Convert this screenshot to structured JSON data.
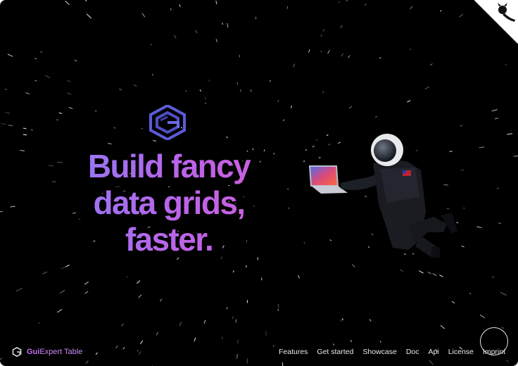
{
  "hero": {
    "line1": "Build fancy",
    "line2": "data grids,",
    "line3": "faster."
  },
  "brand": {
    "bold": "Gui",
    "rest": "Expert Table"
  },
  "nav": [
    {
      "label": "Features"
    },
    {
      "label": "Get started"
    },
    {
      "label": "Showcase"
    },
    {
      "label": "Doc"
    },
    {
      "label": "Api"
    },
    {
      "label": "License"
    },
    {
      "label": "Imprint"
    }
  ],
  "icons": {
    "logo": "gui-expert-logo-icon",
    "github": "github-icon",
    "brand": "gui-expert-small-logo-icon"
  },
  "colors": {
    "background": "#000000",
    "accent_start": "#8b7cf6",
    "accent_end": "#d75cd9",
    "logo": "#5a5ad6"
  }
}
